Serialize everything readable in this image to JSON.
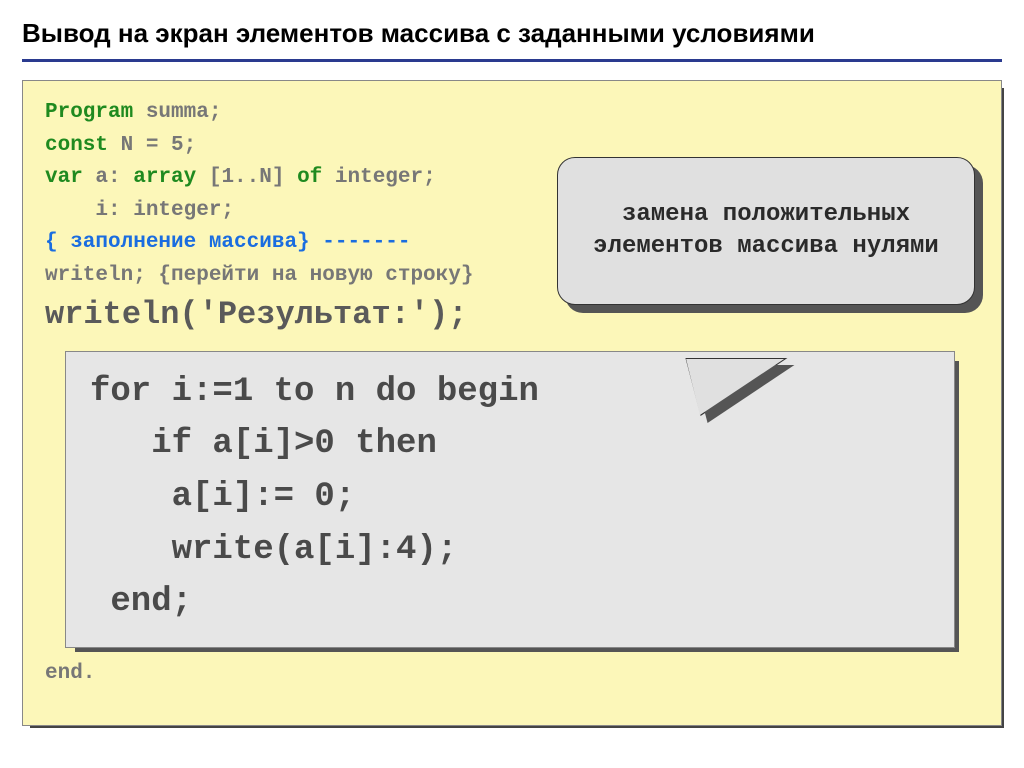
{
  "title": "Вывод на экран элементов массива с заданными условиями",
  "code": {
    "l1a": "Program",
    "l1b": " summa;",
    "l2a": "const",
    "l2b": " N = 5;",
    "l3a": "var ",
    "l3b": "a: ",
    "l3c": "array",
    "l3d": " [1..N] ",
    "l3e": "of",
    "l3f": " integer;",
    "l4": "    i: integer;",
    "l5": "{ заполнение массива} -------",
    "l6": "writeln; {перейти на новую строку}",
    "l7": "writeln('Результат:');",
    "end": "end."
  },
  "inner": {
    "l1": "for i:=1 to n do begin",
    "l2": "   if a[i]>0 then",
    "l3": "    a[i]:= 0;",
    "l4": "    write(a[i]:4);",
    "l5": " end;"
  },
  "callout": "замена положительных элементов массива нулями"
}
